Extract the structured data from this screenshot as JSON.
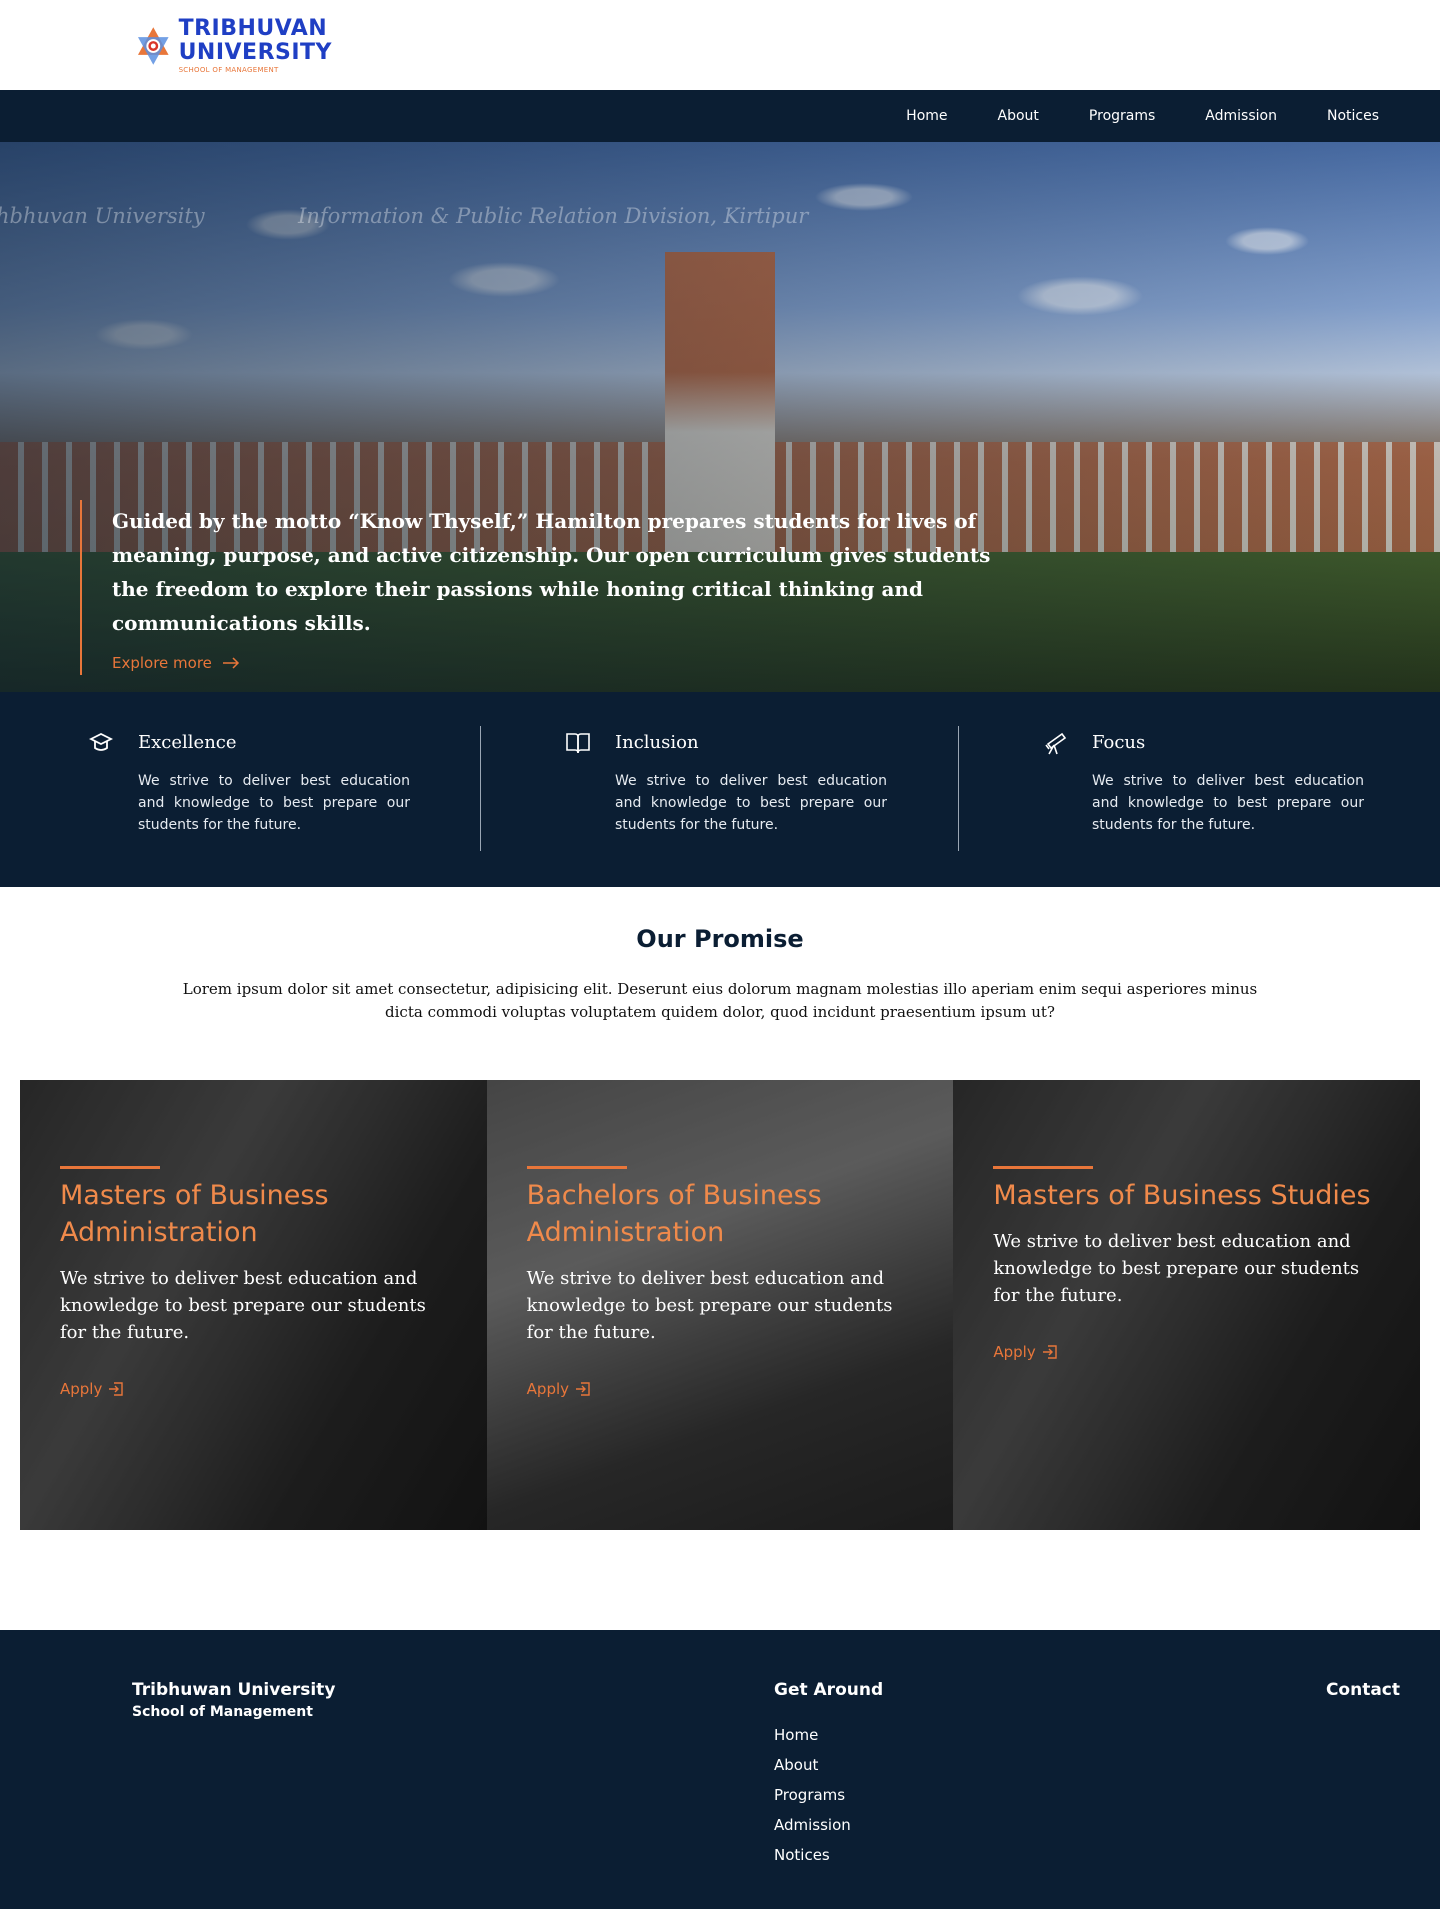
{
  "logo": {
    "line1": "TRIBHUVAN",
    "line2": "UNIVERSITY",
    "line3": "SCHOOL OF MANAGEMENT"
  },
  "nav": {
    "items": [
      "Home",
      "About",
      "Programs",
      "Admission",
      "Notices"
    ]
  },
  "hero": {
    "watermark_left": "hbhuvan University",
    "watermark_right": "Information & Public Relation Division, Kirtipur",
    "text": "Guided by the motto “Know Thyself,” Hamilton prepares students for lives of meaning, purpose, and active citizenship. Our open curriculum gives students the freedom to explore their passions while honing critical thinking and communications skills.",
    "cta": "Explore more",
    "cta_icon": "arrow-right-icon"
  },
  "values": [
    {
      "icon": "graduation-cap-icon",
      "title": "Excellence",
      "text": "We strive to deliver best education and knowledge to best prepare our students for the future."
    },
    {
      "icon": "open-book-icon",
      "title": "Inclusion",
      "text": "We strive to deliver best education and knowledge to best prepare our students for the future."
    },
    {
      "icon": "telescope-icon",
      "title": "Focus",
      "text": "We strive to deliver best education and knowledge to best prepare our students for the future."
    }
  ],
  "promise": {
    "title": "Our Promise",
    "text": "Lorem ipsum dolor sit amet consectetur, adipisicing elit. Deserunt eius dolorum magnam molestias illo aperiam enim sequi asperiores minus dicta commodi voluptas voluptatem quidem dolor, quod incidunt praesentium ipsum ut?"
  },
  "programs": [
    {
      "title": "Masters of Business Administration",
      "text": "We strive to deliver best education and knowledge to best prepare our students for the future.",
      "cta": "Apply"
    },
    {
      "title": "Bachelors of Business Administration",
      "text": "We strive to deliver best education and knowledge to best prepare our students for the future.",
      "cta": "Apply"
    },
    {
      "title": "Masters of Business Studies",
      "text": "We strive to deliver best education and knowledge to best prepare our students for the future.",
      "cta": "Apply"
    }
  ],
  "footer": {
    "brand_line1": "Tribhuwan University",
    "brand_line2": "School of Management",
    "get_around_title": "Get Around",
    "links": [
      "Home",
      "About",
      "Programs",
      "Admission",
      "Notices"
    ],
    "contact_title": "Contact"
  },
  "colors": {
    "navy": "#0b1e33",
    "accent": "#e8763a",
    "logo_blue": "#1f3fc4"
  }
}
